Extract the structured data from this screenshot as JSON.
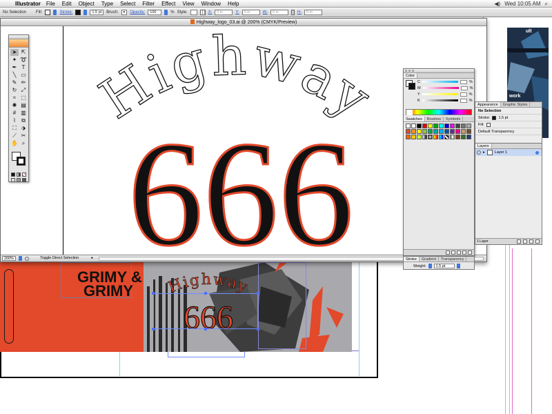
{
  "menubar": {
    "app_name": "Illustrator",
    "items": [
      "File",
      "Edit",
      "Object",
      "Type",
      "Select",
      "Filter",
      "Effect",
      "View",
      "Window",
      "Help"
    ],
    "clock": "Wed 10:05 AM"
  },
  "controlbar": {
    "selection": "No Selection",
    "fill_label": "Fill:",
    "stroke_label": "Stroke:",
    "stroke_weight": "1.5 pt",
    "brush_label": "Brush:",
    "opacity_label": "Opacity:",
    "opacity_value": "100",
    "opacity_unit": "%",
    "style_label": "Style:",
    "x_label": "X:",
    "x_value": "0 in",
    "y_label": "Y:",
    "y_value": "0 in",
    "w_label": "W:",
    "w_value": "0 in",
    "h_label": "H:",
    "h_value": "0 in"
  },
  "document": {
    "title": "Highway_logo_03.ai @ 200% (CMYK/Preview)",
    "logo_word": "Highway",
    "logo_number": "666",
    "zoom": "200%",
    "status": "Toggle Direct Selection"
  },
  "background_art": {
    "grimy_text": "GRIMY &\nGRIMY",
    "small_word": "Highway",
    "small_number": "666"
  },
  "color_panel": {
    "title": "Color",
    "channels": [
      "C",
      "M",
      "Y",
      "K"
    ],
    "percent": "%"
  },
  "swatches_panel": {
    "tabs": [
      "Swatches",
      "Brushes",
      "Symbols"
    ]
  },
  "stroke_panel": {
    "tabs": [
      "Stroke",
      "Gradient",
      "Transparency"
    ],
    "weight_label": "Weight:",
    "weight_value": "1.5 pt"
  },
  "appearance_panel": {
    "tabs": [
      "Appearance",
      "Graphic Styles"
    ],
    "header": "No Selection",
    "stroke_label": "Stroke:",
    "stroke_value": "1.5 pt",
    "fill_label": "Fill:",
    "transparency": "Default Transparency"
  },
  "layers_panel": {
    "tab": "Layers",
    "layer_name": "Layer 1",
    "count": "1 Layer"
  },
  "right_window": {
    "text_1": "ult",
    "text_2": "work"
  },
  "colors": {
    "accent_orange": "#e3492b",
    "logo_black": "#111111",
    "logo_outline": "#e3492b",
    "selection_blue": "#4f6fff",
    "guide_cyan": "#7ed6e8"
  },
  "tools": [
    "selection-tool",
    "direct-selection-tool",
    "magic-wand-tool",
    "lasso-tool",
    "pen-tool",
    "type-tool",
    "line-tool",
    "rectangle-tool",
    "paintbrush-tool",
    "pencil-tool",
    "rotate-tool",
    "scale-tool",
    "warp-tool",
    "free-transform-tool",
    "symbol-sprayer-tool",
    "graph-tool",
    "mesh-tool",
    "gradient-tool",
    "eyedropper-tool",
    "blend-tool",
    "live-paint-tool",
    "live-paint-selection-tool",
    "slice-tool",
    "scissors-tool",
    "hand-tool",
    "zoom-tool"
  ]
}
